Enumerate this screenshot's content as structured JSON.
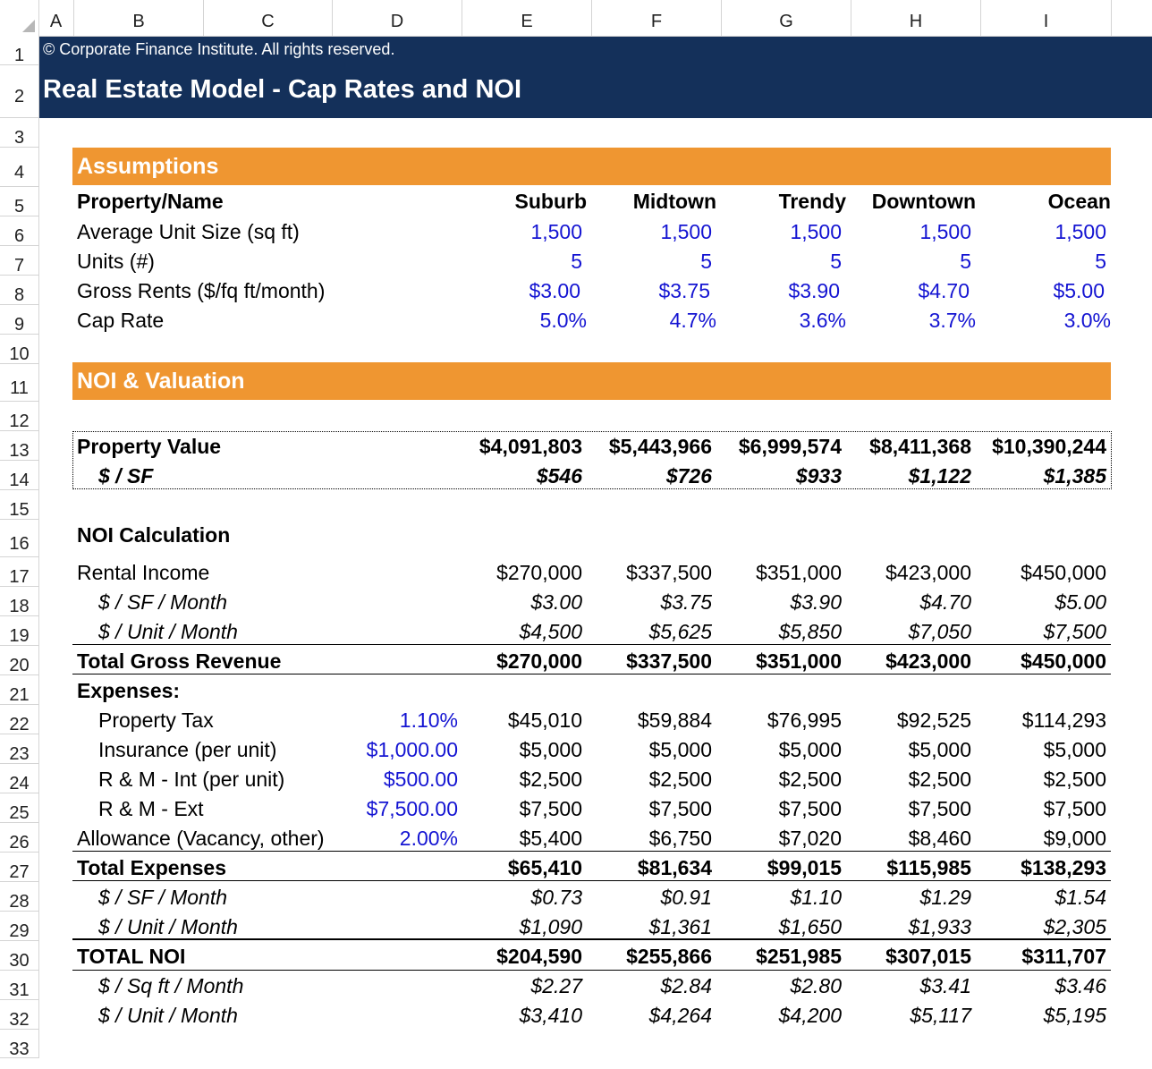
{
  "columns": [
    "A",
    "B",
    "C",
    "D",
    "E",
    "F",
    "G",
    "H",
    "I"
  ],
  "rows": [
    "1",
    "2",
    "3",
    "4",
    "5",
    "6",
    "7",
    "8",
    "9",
    "10",
    "11",
    "12",
    "13",
    "14",
    "15",
    "16",
    "17",
    "18",
    "19",
    "20",
    "21",
    "22",
    "23",
    "24",
    "25",
    "26",
    "27",
    "28",
    "29",
    "30",
    "31",
    "32",
    "33"
  ],
  "header": {
    "copyright": "© Corporate Finance Institute. All rights reserved.",
    "title": "Real Estate Model - Cap Rates and NOI"
  },
  "assumptions": {
    "section_title": "Assumptions",
    "property_label": "Property/Name",
    "properties": [
      "Suburb",
      "Midtown",
      "Trendy",
      "Downtown",
      "Ocean"
    ],
    "rows": [
      {
        "label": "Average Unit Size (sq ft)",
        "values": [
          "1,500",
          "1,500",
          "1,500",
          "1,500",
          "1,500"
        ]
      },
      {
        "label": "Units (#)",
        "values": [
          "5",
          "5",
          "5",
          "5",
          "5"
        ]
      },
      {
        "label": "Gross Rents ($/fq ft/month)",
        "values": [
          "$3.00",
          "$3.75",
          "$3.90",
          "$4.70",
          "$5.00"
        ]
      },
      {
        "label": "Cap Rate",
        "values": [
          "5.0%",
          "4.7%",
          "3.6%",
          "3.7%",
          "3.0%"
        ]
      }
    ]
  },
  "valuation": {
    "section_title": "NOI & Valuation",
    "property_value": {
      "label": "Property Value",
      "values": [
        "$4,091,803",
        "$5,443,966",
        "$6,999,574",
        "$8,411,368",
        "$10,390,244"
      ]
    },
    "per_sf": {
      "label": "$ / SF",
      "values": [
        "$546",
        "$726",
        "$933",
        "$1,122",
        "$1,385"
      ]
    }
  },
  "noi": {
    "title": "NOI Calculation",
    "rental_income": {
      "label": "Rental Income",
      "values": [
        "$270,000",
        "$337,500",
        "$351,000",
        "$423,000",
        "$450,000"
      ]
    },
    "ri_sf_month": {
      "label": "$ / SF / Month",
      "values": [
        "$3.00",
        "$3.75",
        "$3.90",
        "$4.70",
        "$5.00"
      ]
    },
    "ri_unit_month": {
      "label": "$ / Unit / Month",
      "values": [
        "$4,500",
        "$5,625",
        "$5,850",
        "$7,050",
        "$7,500"
      ]
    },
    "total_gross_revenue": {
      "label": "Total Gross Revenue",
      "values": [
        "$270,000",
        "$337,500",
        "$351,000",
        "$423,000",
        "$450,000"
      ]
    },
    "expenses_label": "Expenses:",
    "expenses": [
      {
        "label": "Property Tax",
        "input": "1.10%",
        "values": [
          "$45,010",
          "$59,884",
          "$76,995",
          "$92,525",
          "$114,293"
        ]
      },
      {
        "label": "Insurance (per unit)",
        "input": "$1,000.00",
        "values": [
          "$5,000",
          "$5,000",
          "$5,000",
          "$5,000",
          "$5,000"
        ]
      },
      {
        "label": "R & M - Int (per unit)",
        "input": "$500.00",
        "values": [
          "$2,500",
          "$2,500",
          "$2,500",
          "$2,500",
          "$2,500"
        ]
      },
      {
        "label": "R & M - Ext",
        "input": "$7,500.00",
        "values": [
          "$7,500",
          "$7,500",
          "$7,500",
          "$7,500",
          "$7,500"
        ]
      },
      {
        "label": "Allowance (Vacancy, other)",
        "input": "2.00%",
        "values": [
          "$5,400",
          "$6,750",
          "$7,020",
          "$8,460",
          "$9,000"
        ]
      }
    ],
    "total_expenses": {
      "label": "Total Expenses",
      "values": [
        "$65,410",
        "$81,634",
        "$99,015",
        "$115,985",
        "$138,293"
      ]
    },
    "te_sf_month": {
      "label": "$ / SF / Month",
      "values": [
        "$0.73",
        "$0.91",
        "$1.10",
        "$1.29",
        "$1.54"
      ]
    },
    "te_unit_month": {
      "label": "$ / Unit / Month",
      "values": [
        "$1,090",
        "$1,361",
        "$1,650",
        "$1,933",
        "$2,305"
      ]
    },
    "total_noi": {
      "label": "TOTAL NOI",
      "values": [
        "$204,590",
        "$255,866",
        "$251,985",
        "$307,015",
        "$311,707"
      ]
    },
    "noi_sqft_month": {
      "label": "$ / Sq ft / Month",
      "values": [
        "$2.27",
        "$2.84",
        "$2.80",
        "$3.41",
        "$3.46"
      ]
    },
    "noi_unit_month": {
      "label": "$ / Unit / Month",
      "values": [
        "$3,410",
        "$4,264",
        "$4,200",
        "$5,117",
        "$5,195"
      ]
    }
  }
}
